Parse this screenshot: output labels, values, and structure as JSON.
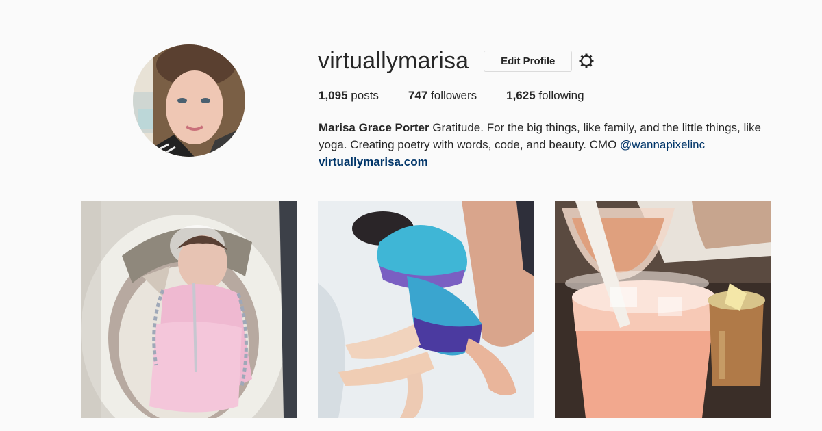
{
  "profile": {
    "username": "virtuallymarisa",
    "edit_profile_label": "Edit Profile",
    "settings_icon": "gear-icon"
  },
  "stats": {
    "posts_count": "1,095",
    "posts_label": "posts",
    "followers_count": "747",
    "followers_label": "followers",
    "following_count": "1,625",
    "following_label": "following"
  },
  "bio": {
    "full_name": "Marisa Grace Porter",
    "text": " Gratitude. For the big things, like family, and the little things, like yoga. Creating poetry with words, code, and beauty. CMO ",
    "mention": "@wannapixelinc",
    "website": "virtuallymarisa.com"
  },
  "colors": {
    "background": "#fafafa",
    "text": "#262626",
    "link": "#003569",
    "border": "#dbdbdb"
  },
  "posts": [
    {
      "subject": "baby-photo"
    },
    {
      "subject": "child-at-beach-photo"
    },
    {
      "subject": "cocktails-photo"
    }
  ]
}
